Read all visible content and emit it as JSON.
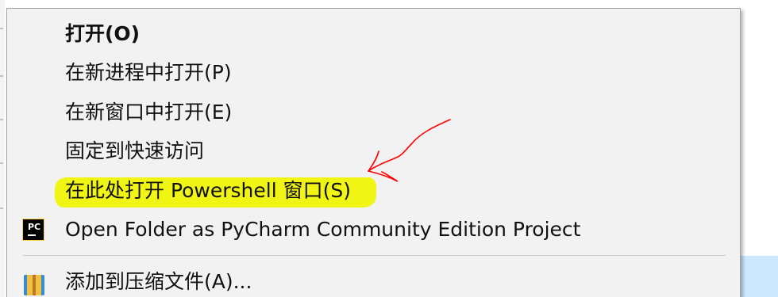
{
  "context_menu": {
    "items": [
      {
        "label": "打开(O)",
        "bold": true
      },
      {
        "label": "在新进程中打开(P)"
      },
      {
        "label": "在新窗口中打开(E)"
      },
      {
        "label": "固定到快速访问"
      },
      {
        "label": "在此处打开 Powershell 窗口(S)",
        "highlighted": true
      },
      {
        "label": "Open Folder as PyCharm Community Edition Project",
        "icon": "pycharm-icon"
      },
      {
        "label": "添加到压缩文件(A)...",
        "icon": "winrar-archive-icon"
      }
    ]
  },
  "annotation": {
    "highlight_color": "#f0f500",
    "arrow_color": "#ff0000"
  },
  "pycharm_icon_text": "PC"
}
